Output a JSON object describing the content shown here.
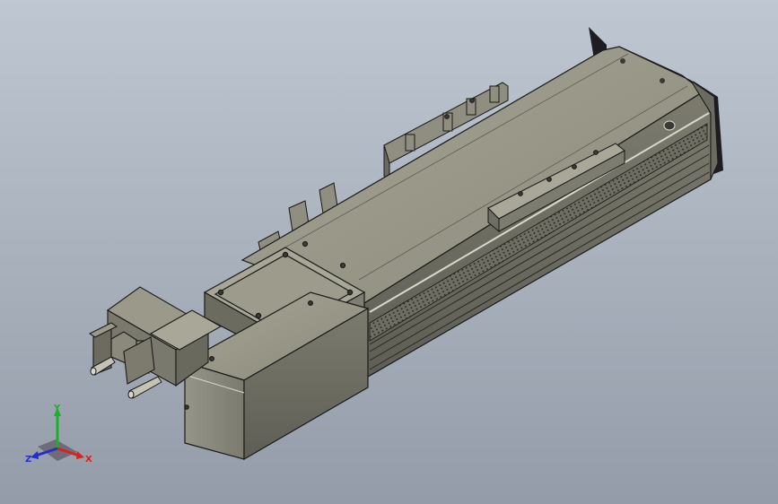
{
  "viewport": {
    "background_top": "#bfc7d2",
    "background_bottom": "#939ca8",
    "model_color": "#8d8c7e",
    "model_highlight": "#a9a898",
    "model_shadow": "#5e5d53",
    "edge_color": "#1a1a18"
  },
  "triad": {
    "x_label": "X",
    "y_label": "Y",
    "z_label": "Z",
    "x_color": "#d8231c",
    "y_color": "#1fae2a",
    "z_color": "#2330c8"
  }
}
